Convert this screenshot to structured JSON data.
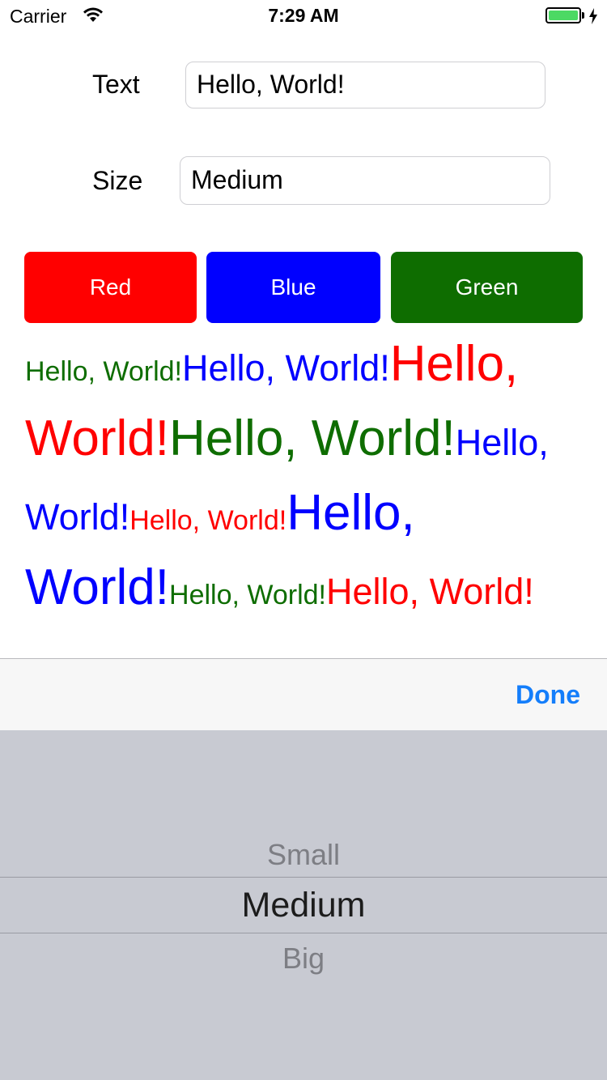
{
  "status_bar": {
    "carrier": "Carrier",
    "time": "7:29 AM",
    "battery_level": 1.0
  },
  "form": {
    "text_label": "Text",
    "text_value": "Hello, World!",
    "size_label": "Size",
    "size_value": "Medium"
  },
  "color_buttons": [
    {
      "label": "Red",
      "color": "#ff0000"
    },
    {
      "label": "Blue",
      "color": "#0000ff"
    },
    {
      "label": "Green",
      "color": "#0e6d00"
    }
  ],
  "result_runs": [
    {
      "text": "Hello, World!",
      "color": "#0e6d00",
      "size": "Small"
    },
    {
      "text": "Hello, World!",
      "color": "#0000ff",
      "size": "Medium"
    },
    {
      "text": "Hello, World!",
      "color": "#ff0000",
      "size": "Big"
    },
    {
      "text": "Hello, World!",
      "color": "#0e6d00",
      "size": "Big"
    },
    {
      "text": "Hello, World!",
      "color": "#0000ff",
      "size": "Medium"
    },
    {
      "text": "Hello, World!",
      "color": "#ff0000",
      "size": "Small"
    },
    {
      "text": "Hello, World!",
      "color": "#0000ff",
      "size": "Big"
    },
    {
      "text": "Hello, World!",
      "color": "#0e6d00",
      "size": "Small"
    },
    {
      "text": "Hello, World!",
      "color": "#ff0000",
      "size": "Medium"
    }
  ],
  "accessory": {
    "done_label": "Done",
    "accent": "#147efb"
  },
  "picker": {
    "options": [
      "Small",
      "Medium",
      "Big"
    ],
    "selected": "Medium"
  }
}
